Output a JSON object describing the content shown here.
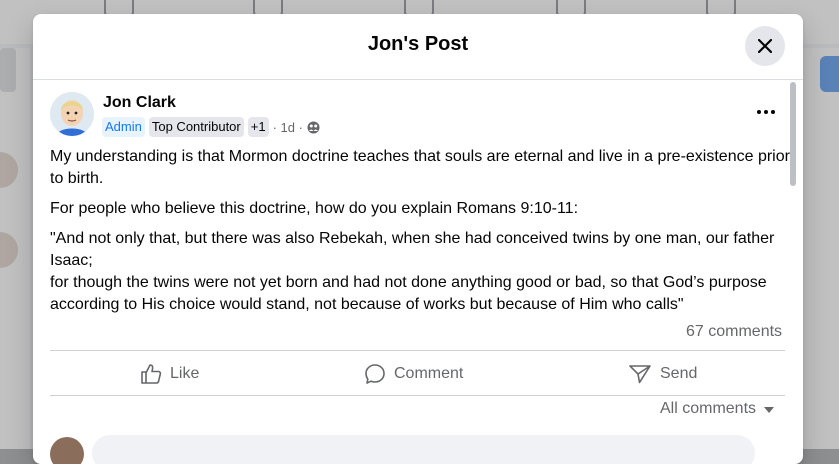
{
  "dialog": {
    "title": "Jon's Post",
    "close_icon": "close-icon"
  },
  "post": {
    "author": "Jon Clark",
    "badges": [
      "Admin",
      "Top Contributor",
      "+1"
    ],
    "time": "· 1d ·",
    "audience_icon": "group-audience-icon",
    "more_icon": "more-options-icon",
    "body": [
      "My understanding is that Mormon doctrine teaches that souls are eternal and live in a pre-existence prior to birth.",
      "For people who believe this doctrine, how do you explain Romans 9:10-11:",
      "\"And not only that, but there was also Rebekah, when she had conceived twins by one man, our father Isaac;",
      "for though the twins were not yet born and had not done anything good or bad, so that God’s purpose according to His choice would stand, not because of works but because of Him who calls\""
    ],
    "comment_count": "67 comments"
  },
  "actions": {
    "like": "Like",
    "comment": "Comment",
    "send": "Send"
  },
  "comments": {
    "filter_label": "All comments"
  },
  "colors": {
    "accent": "#1877f2",
    "secondary_text": "#65676b",
    "divider": "#ced0d4"
  }
}
